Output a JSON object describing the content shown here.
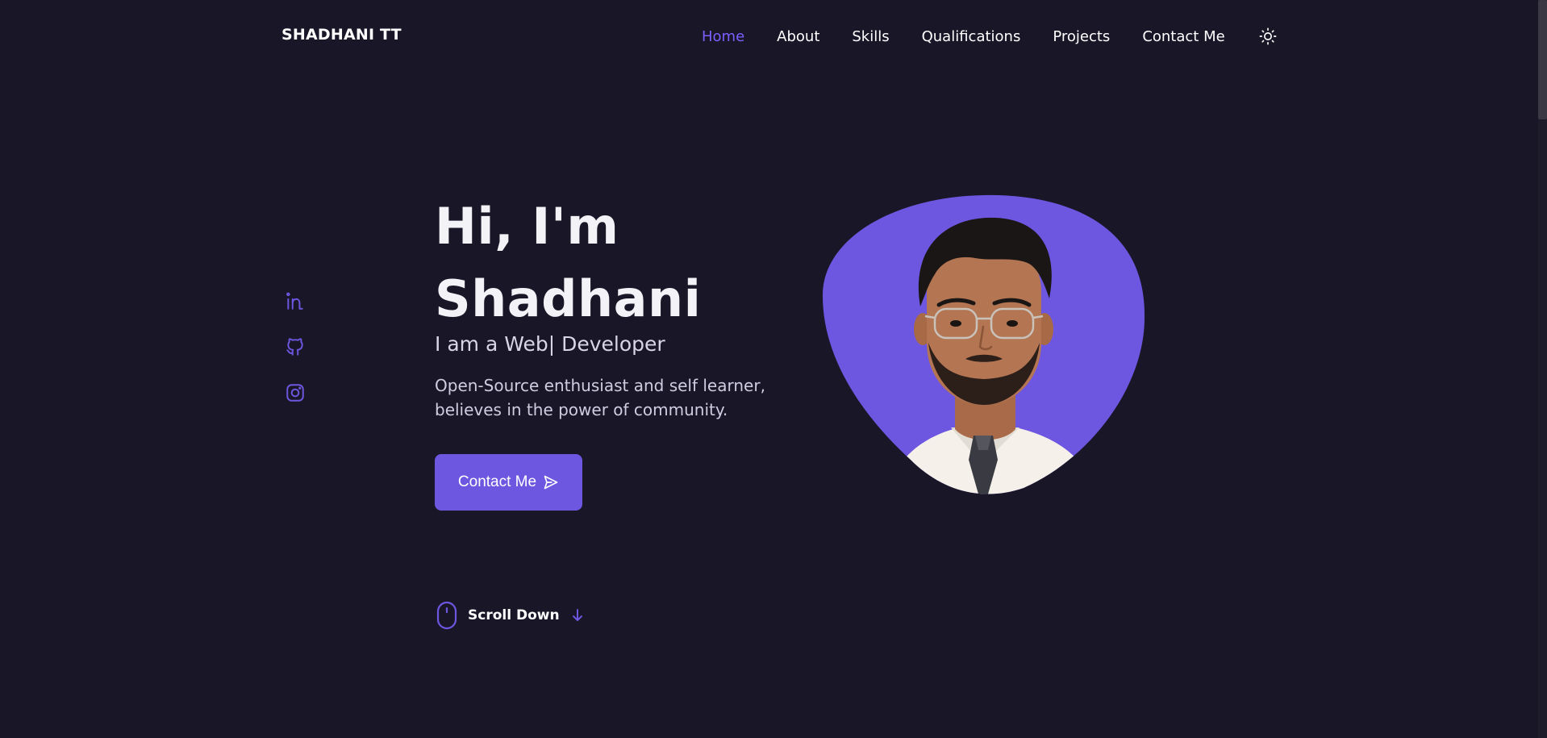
{
  "header": {
    "logo": "SHADHANI TT",
    "nav": [
      {
        "label": "Home",
        "active": true
      },
      {
        "label": "About",
        "active": false
      },
      {
        "label": "Skills",
        "active": false
      },
      {
        "label": "Qualifications",
        "active": false
      },
      {
        "label": "Projects",
        "active": false
      },
      {
        "label": "Contact Me",
        "active": false
      }
    ],
    "theme_toggle_icon": "sun-icon"
  },
  "social": {
    "items": [
      {
        "name": "linkedin-icon"
      },
      {
        "name": "github-icon"
      },
      {
        "name": "instagram-icon"
      }
    ]
  },
  "hero": {
    "title_line1": "Hi, I'm",
    "title_line2": "Shadhani",
    "subtitle": "I am a Web| Developer",
    "description": "Open-Source enthusiast and self learner, believes in the power of community.",
    "cta_label": "Contact Me",
    "cta_icon": "send-icon"
  },
  "scroll": {
    "label": "Scroll Down",
    "mouse_icon": "mouse-icon",
    "arrow_icon": "arrow-down-icon"
  },
  "colors": {
    "background": "#191627",
    "accent": "#6d57e0",
    "accent_text": "#7b5fff",
    "text": "#ffffff"
  }
}
